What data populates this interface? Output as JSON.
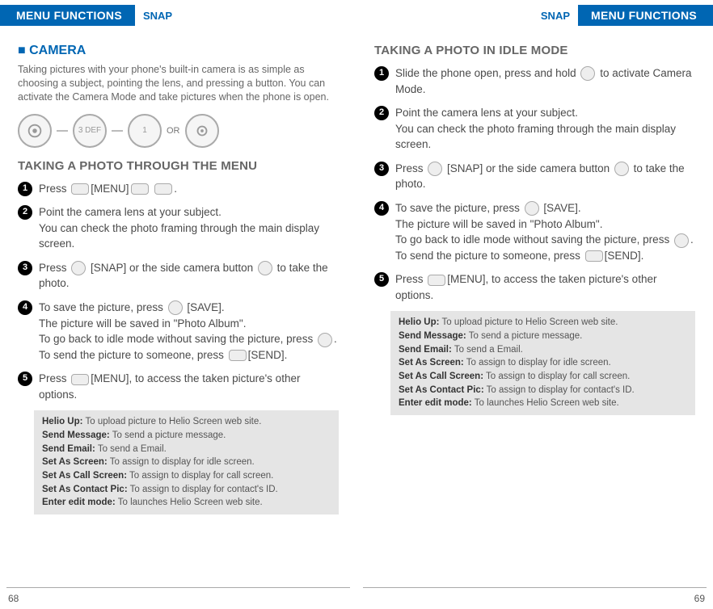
{
  "header": {
    "tab_label": "MENU FUNCTIONS",
    "snap": "SNAP"
  },
  "left": {
    "section_title": "■ CAMERA",
    "intro": "Taking pictures with your phone's built-in camera is as simple as choosing a subject, pointing the lens, and pressing a button. You can activate the Camera Mode and take pictures when the phone is open.",
    "or": "OR",
    "subheading": "TAKING A PHOTO THROUGH THE MENU",
    "steps": [
      "Press  [MENU]  .",
      "Point the camera lens at your subject.\nYou can check the photo framing through the main display screen.",
      "Press  [SNAP] or the side camera button  to take the photo.",
      "To save the picture, press  [SAVE].\nThe picture will be saved in \"Photo Album\".\nTo go back to idle mode without saving the picture, press  .\nTo send the picture to someone, press  [SEND].",
      "Press  [MENU], to access the taken picture's other options."
    ],
    "options": [
      {
        "k": "Helio Up:",
        "v": "To upload picture to Helio Screen web site."
      },
      {
        "k": "Send Message:",
        "v": "To send a picture message."
      },
      {
        "k": "Send Email:",
        "v": "To send a Email."
      },
      {
        "k": "Set As Screen:",
        "v": "To assign to display for idle screen."
      },
      {
        "k": "Set As Call Screen:",
        "v": "To assign to display for call screen."
      },
      {
        "k": "Set As Contact Pic:",
        "v": "To assign to display for contact's ID."
      },
      {
        "k": "Enter edit mode:",
        "v": "To launches Helio Screen web site."
      }
    ],
    "page_num": "68"
  },
  "right": {
    "subheading": "TAKING A PHOTO IN IDLE MODE",
    "steps": [
      "Slide the phone open, press and hold  to activate Camera Mode.",
      "Point the camera lens at your subject.\nYou can check the photo framing through the main display screen.",
      "Press  [SNAP] or the side camera button  to take the photo.",
      "To save the picture, press  [SAVE].\nThe picture will be saved in \"Photo Album\".\nTo go back to idle mode without saving the picture, press  .\nTo send the picture to someone, press  [SEND].",
      "Press  [MENU], to access the taken picture's other options."
    ],
    "options": [
      {
        "k": "Helio Up:",
        "v": "To upload picture to Helio Screen web site."
      },
      {
        "k": "Send Message:",
        "v": "To send a picture message."
      },
      {
        "k": "Send Email:",
        "v": "To send a Email."
      },
      {
        "k": "Set As Screen:",
        "v": "To assign to display for idle screen."
      },
      {
        "k": "Set As Call Screen:",
        "v": "To assign to display for call screen."
      },
      {
        "k": "Set As Contact Pic:",
        "v": "To assign to display for contact's ID."
      },
      {
        "k": "Enter edit mode:",
        "v": "To launches Helio Screen web site."
      }
    ],
    "page_num": "69"
  }
}
